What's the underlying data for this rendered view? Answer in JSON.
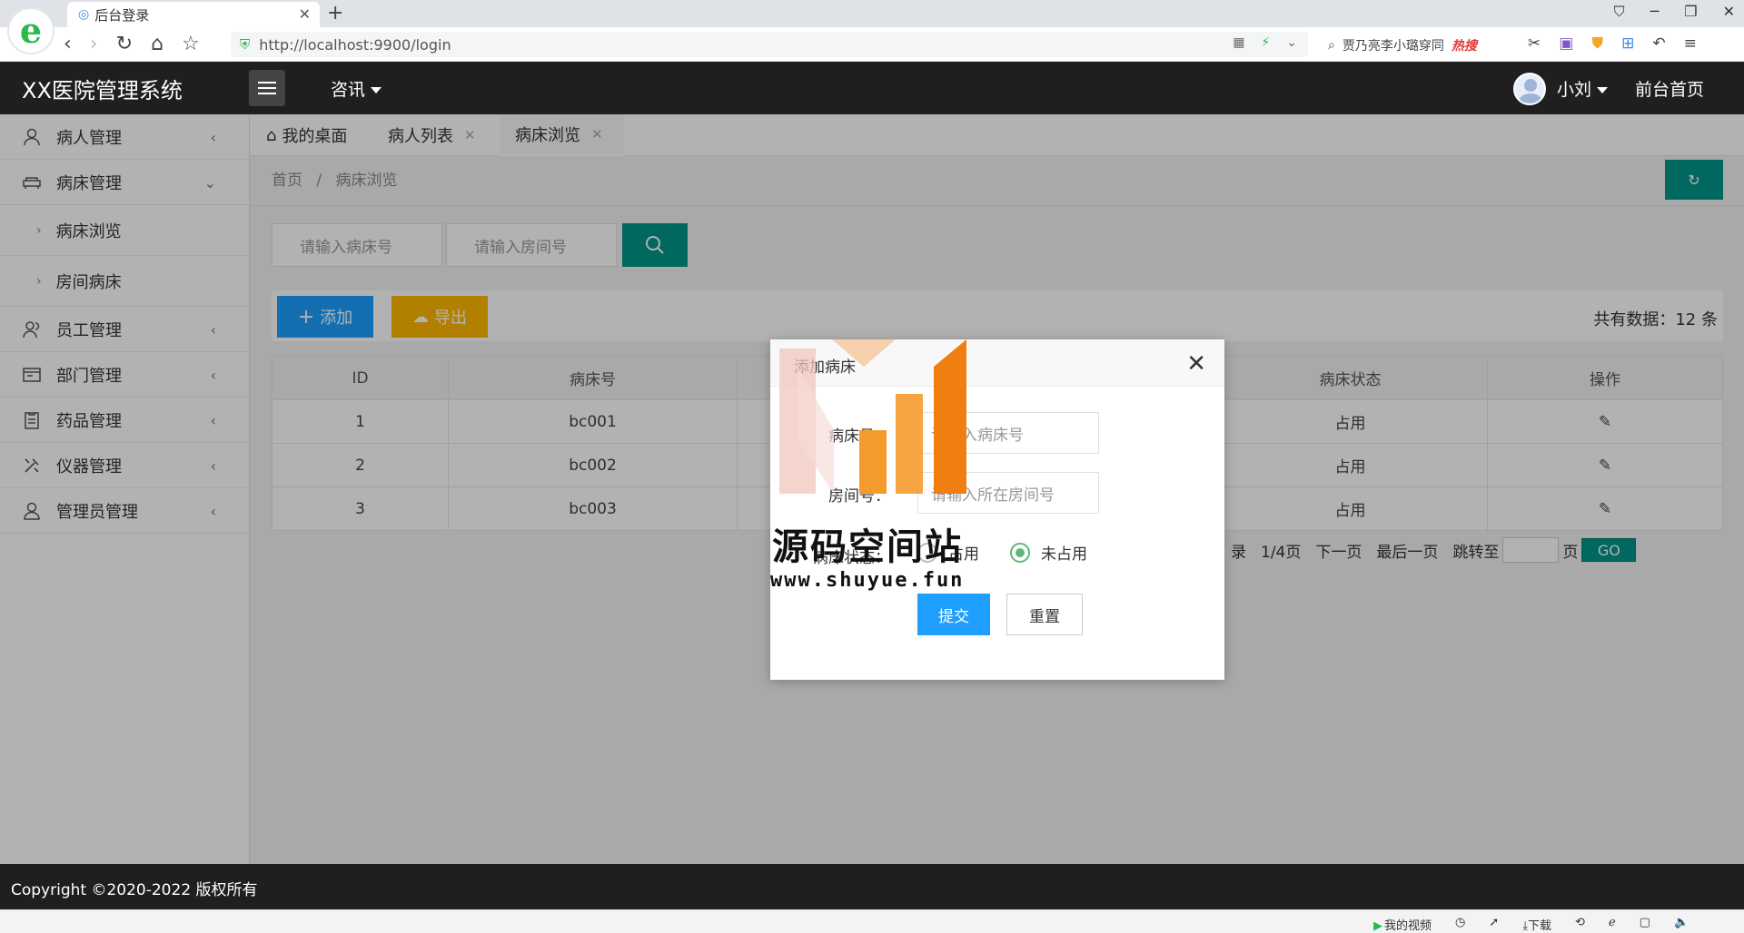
{
  "browser": {
    "tab_title": "后台登录",
    "url": "http://localhost:9900/login",
    "search_hint": "贾乃亮李小璐穿同",
    "hot_label": "热搜"
  },
  "header": {
    "app_title": "XX医院管理系统",
    "news_menu": "咨讯",
    "user_name": "小刘",
    "front_home": "前台首页"
  },
  "sidebar": {
    "items": [
      {
        "label": "病人管理"
      },
      {
        "label": "病床管理"
      },
      {
        "label": "员工管理"
      },
      {
        "label": "部门管理"
      },
      {
        "label": "药品管理"
      },
      {
        "label": "仪器管理"
      },
      {
        "label": "管理员管理"
      }
    ],
    "sub_items": [
      {
        "label": "病床浏览"
      },
      {
        "label": "房间病床"
      }
    ]
  },
  "tabs": [
    {
      "label": "我的桌面"
    },
    {
      "label": "病人列表"
    },
    {
      "label": "病床浏览"
    }
  ],
  "breadcrumb": {
    "home": "首页",
    "separator": "/",
    "current": "病床浏览"
  },
  "search": {
    "bed_placeholder": "请输入病床号",
    "room_placeholder": "请输入房间号"
  },
  "toolbar": {
    "add_label": "添加",
    "export_label": "导出",
    "total_label": "共有数据：12 条"
  },
  "table": {
    "columns": [
      "ID",
      "病床号",
      "",
      "病床状态",
      "操作"
    ],
    "rows": [
      {
        "id": "1",
        "bed": "bc001",
        "status": "占用"
      },
      {
        "id": "2",
        "bed": "bc002",
        "status": "占用"
      },
      {
        "id": "3",
        "bed": "bc003",
        "status": "占用"
      }
    ]
  },
  "pagination": {
    "record_suffix": "录",
    "page_info": "1/4页",
    "next": "下一页",
    "last": "最后一页",
    "jump_to": "跳转至",
    "page_unit": "页",
    "go": "GO"
  },
  "modal": {
    "title": "添加病床",
    "bed_label": "病床号：",
    "bed_placeholder": "请输入病床号",
    "room_label": "房间号：",
    "room_placeholder": "请输入所在房间号",
    "status_label": "病床状态：",
    "opt_occupied": "占用",
    "opt_free": "未占用",
    "submit": "提交",
    "reset": "重置"
  },
  "watermark": {
    "text": "源码空间站",
    "url": "www.shuyue.fun"
  },
  "footer": {
    "copyright": "Copyright ©2020-2022 版权所有"
  },
  "statusbar": {
    "my_video": "我的视频",
    "download": "下载"
  },
  "colors": {
    "teal": "#009688",
    "blue": "#1e9fff",
    "yellow": "#ffb800",
    "header_bg": "#1f1f1f"
  }
}
